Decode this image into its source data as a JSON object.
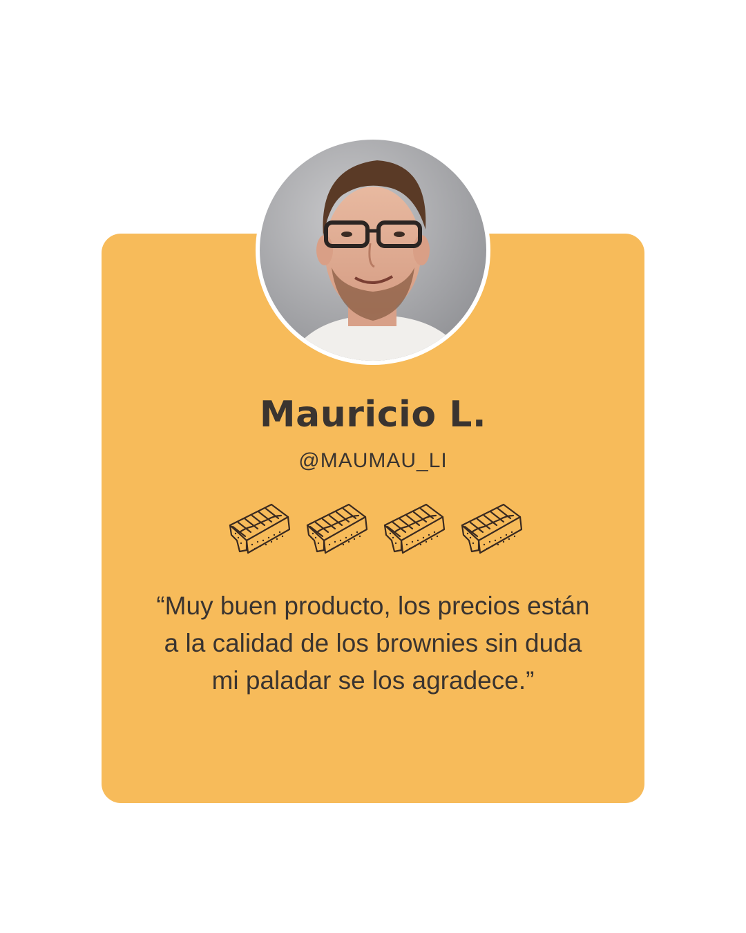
{
  "reviewer": {
    "name": "Mauricio L.",
    "handle": "@MAUMAU_LI"
  },
  "rating": {
    "value": 4,
    "icon": "brownie-icon"
  },
  "review": {
    "text": "“Muy buen producto, los precios están a la calidad de los brownies sin duda mi paladar se los agradece.”"
  },
  "colors": {
    "card": "#f7bb5a",
    "text": "#3a3430",
    "background": "#ffffff"
  }
}
